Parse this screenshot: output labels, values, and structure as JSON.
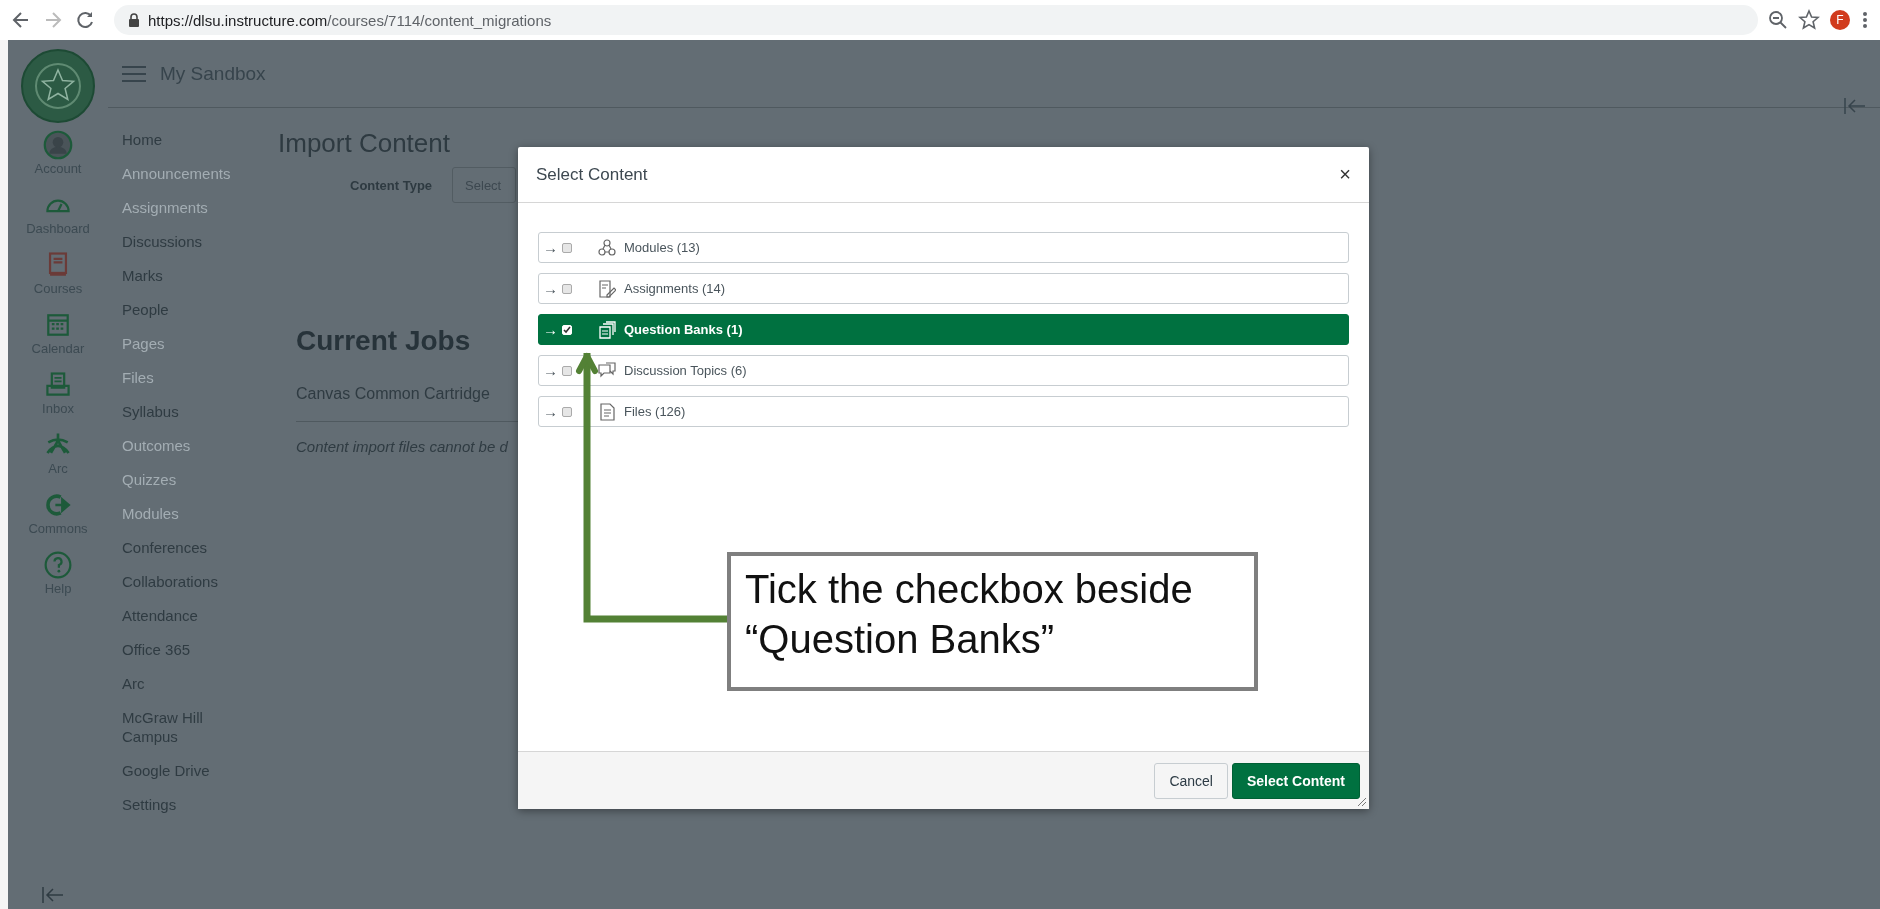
{
  "browser": {
    "url_host": "https://dlsu.instructure.com",
    "url_path": "/courses/7114/content_migrations",
    "profile_initial": "F"
  },
  "global_nav": [
    {
      "label": "Account"
    },
    {
      "label": "Dashboard"
    },
    {
      "label": "Courses"
    },
    {
      "label": "Calendar"
    },
    {
      "label": "Inbox"
    },
    {
      "label": "Arc"
    },
    {
      "label": "Commons"
    },
    {
      "label": "Help"
    }
  ],
  "header": {
    "title": "My Sandbox"
  },
  "course_nav": [
    {
      "label": "Home",
      "disabled": false
    },
    {
      "label": "Announcements",
      "disabled": true
    },
    {
      "label": "Assignments",
      "disabled": true
    },
    {
      "label": "Discussions",
      "disabled": false
    },
    {
      "label": "Marks",
      "disabled": false
    },
    {
      "label": "People",
      "disabled": false
    },
    {
      "label": "Pages",
      "disabled": true
    },
    {
      "label": "Files",
      "disabled": true
    },
    {
      "label": "Syllabus",
      "disabled": false
    },
    {
      "label": "Outcomes",
      "disabled": true
    },
    {
      "label": "Quizzes",
      "disabled": true
    },
    {
      "label": "Modules",
      "disabled": true
    },
    {
      "label": "Conferences",
      "disabled": false
    },
    {
      "label": "Collaborations",
      "disabled": false
    },
    {
      "label": "Attendance",
      "disabled": false
    },
    {
      "label": "Office 365",
      "disabled": false
    },
    {
      "label": "Arc",
      "disabled": false
    },
    {
      "label": "McGraw Hill Campus",
      "disabled": false
    },
    {
      "label": "Google Drive",
      "disabled": false
    },
    {
      "label": "Settings",
      "disabled": false
    }
  ],
  "main": {
    "title": "Import Content",
    "content_type_label": "Content Type",
    "content_type_value": "Select",
    "jobs_title": "Current Jobs",
    "job": "Canvas Common Cartridge",
    "note": "Content import files cannot be d"
  },
  "modal": {
    "title": "Select Content",
    "close": "×",
    "items": [
      {
        "arrow": "→",
        "label": "Modules (13)",
        "checked": false,
        "selected": false
      },
      {
        "arrow": "→",
        "label": "Assignments (14)",
        "checked": false,
        "selected": false
      },
      {
        "arrow": "→",
        "label": "Question Banks (1)",
        "checked": true,
        "selected": true
      },
      {
        "arrow": "→",
        "label": "Discussion Topics (6)",
        "checked": false,
        "selected": false
      },
      {
        "arrow": "→",
        "label": "Files (126)",
        "checked": false,
        "selected": false
      }
    ],
    "buttons": [
      {
        "label": "Cancel",
        "kind": "secondary"
      },
      {
        "label": "Select Content",
        "kind": "primary"
      }
    ]
  },
  "callout": {
    "text": "Tick the checkbox beside “Question Banks”"
  }
}
